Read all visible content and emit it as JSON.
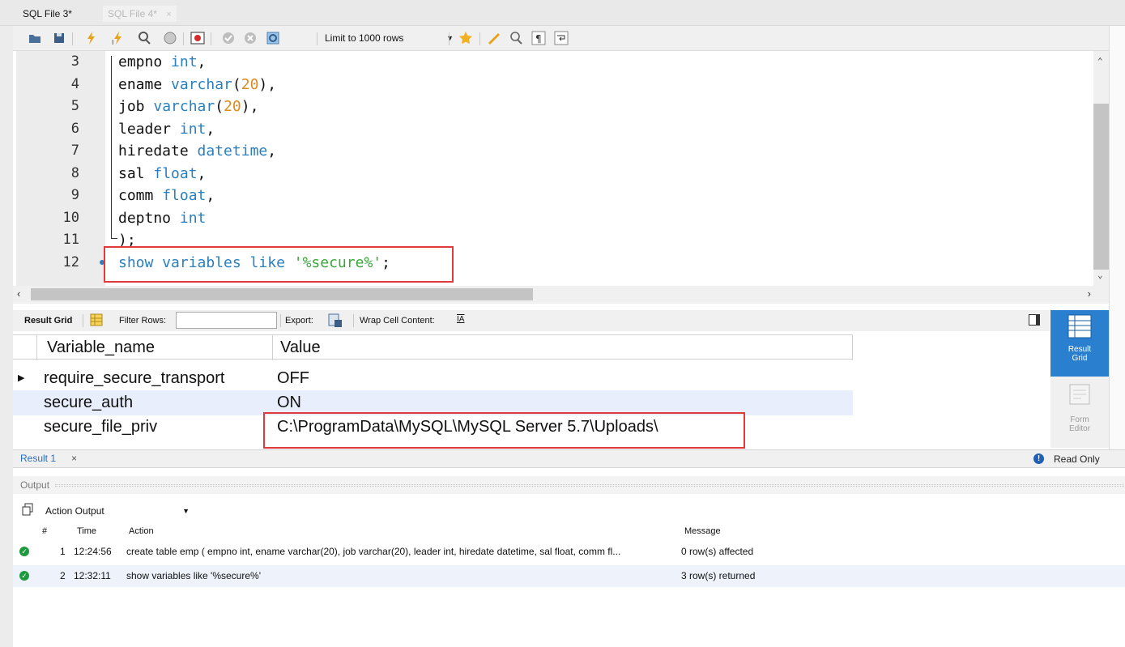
{
  "tabs": [
    {
      "label": "SQL File 3*",
      "active": true
    },
    {
      "label": "SQL File 4*",
      "active": false,
      "close": "×"
    }
  ],
  "toolbar": {
    "limit_select_value": "Limit to 1000 rows",
    "icons": [
      "open-folder-icon",
      "save-icon",
      "execute-icon",
      "execute-current-icon",
      "explain-icon",
      "stop-icon",
      "toggle-error-icon",
      "commit-icon",
      "rollback-icon",
      "autocommit-icon",
      "favorite-icon",
      "beautify-icon",
      "find-icon",
      "invisible-chars-icon",
      "wrap-icon"
    ]
  },
  "editor": {
    "lines": [
      {
        "n": "3",
        "tokens": [
          {
            "t": "empno ",
            "c": ""
          },
          {
            "t": "int",
            "c": "kw"
          },
          {
            "t": ",",
            "c": ""
          }
        ]
      },
      {
        "n": "4",
        "tokens": [
          {
            "t": "ename ",
            "c": ""
          },
          {
            "t": "varchar",
            "c": "kw"
          },
          {
            "t": "(",
            "c": ""
          },
          {
            "t": "20",
            "c": "num"
          },
          {
            "t": "),",
            "c": ""
          }
        ]
      },
      {
        "n": "5",
        "tokens": [
          {
            "t": "job ",
            "c": ""
          },
          {
            "t": "varchar",
            "c": "kw"
          },
          {
            "t": "(",
            "c": ""
          },
          {
            "t": "20",
            "c": "num"
          },
          {
            "t": "),",
            "c": ""
          }
        ]
      },
      {
        "n": "6",
        "tokens": [
          {
            "t": "leader ",
            "c": ""
          },
          {
            "t": "int",
            "c": "kw"
          },
          {
            "t": ",",
            "c": ""
          }
        ]
      },
      {
        "n": "7",
        "tokens": [
          {
            "t": "hiredate ",
            "c": ""
          },
          {
            "t": "datetime",
            "c": "kw"
          },
          {
            "t": ",",
            "c": ""
          }
        ]
      },
      {
        "n": "8",
        "tokens": [
          {
            "t": "sal ",
            "c": ""
          },
          {
            "t": "float",
            "c": "kw"
          },
          {
            "t": ",",
            "c": ""
          }
        ]
      },
      {
        "n": "9",
        "tokens": [
          {
            "t": "comm ",
            "c": ""
          },
          {
            "t": "float",
            "c": "kw"
          },
          {
            "t": ",",
            "c": ""
          }
        ]
      },
      {
        "n": "10",
        "tokens": [
          {
            "t": "deptno ",
            "c": ""
          },
          {
            "t": "int",
            "c": "kw"
          }
        ]
      },
      {
        "n": "11",
        "tokens": [
          {
            "t": ");",
            "c": ""
          }
        ]
      },
      {
        "n": "12",
        "tokens": [
          {
            "t": "show variables like ",
            "c": "kw"
          },
          {
            "t": "'%secure%'",
            "c": "str"
          },
          {
            "t": ";",
            "c": ""
          }
        ]
      }
    ]
  },
  "result_toolbar": {
    "result_grid_label": "Result Grid",
    "filter_rows_label": "Filter Rows:",
    "filter_rows_value": "",
    "export_label": "Export:",
    "wrap_label": "Wrap Cell Content:",
    "wrap_icon_text": "IA"
  },
  "grid": {
    "columns": [
      "Variable_name",
      "Value"
    ],
    "rows": [
      {
        "name": "require_secure_transport",
        "value": "OFF",
        "current": true
      },
      {
        "name": "secure_auth",
        "value": "ON",
        "current": false
      },
      {
        "name": "secure_file_priv",
        "value": "C:\\ProgramData\\MySQL\\MySQL Server 5.7\\Uploads\\",
        "current": false
      }
    ]
  },
  "sidebar": {
    "result_grid": "Result\nGrid",
    "form_editor": "Form\nEditor"
  },
  "result_tabs": {
    "tab_label": "Result 1",
    "close": "×",
    "read_only": "Read Only"
  },
  "output": {
    "header": "Output",
    "selector_value": "Action Output",
    "columns": {
      "num": "#",
      "time": "Time",
      "action": "Action",
      "message": "Message"
    },
    "rows": [
      {
        "num": "1",
        "time": "12:24:56",
        "action": "create table emp ( empno int, ename varchar(20), job varchar(20), leader int, hiredate datetime, sal float, comm fl...",
        "message": "0 row(s) affected"
      },
      {
        "num": "2",
        "time": "12:32:11",
        "action": "show variables like '%secure%'",
        "message": "3 row(s) returned"
      }
    ]
  },
  "colors": {
    "highlight_border": "#e23a3a",
    "keyword": "#2a7fbf",
    "number": "#e08a1e",
    "string": "#3aa63a",
    "accent": "#2a7fcf",
    "ok": "#1e9a3e"
  }
}
